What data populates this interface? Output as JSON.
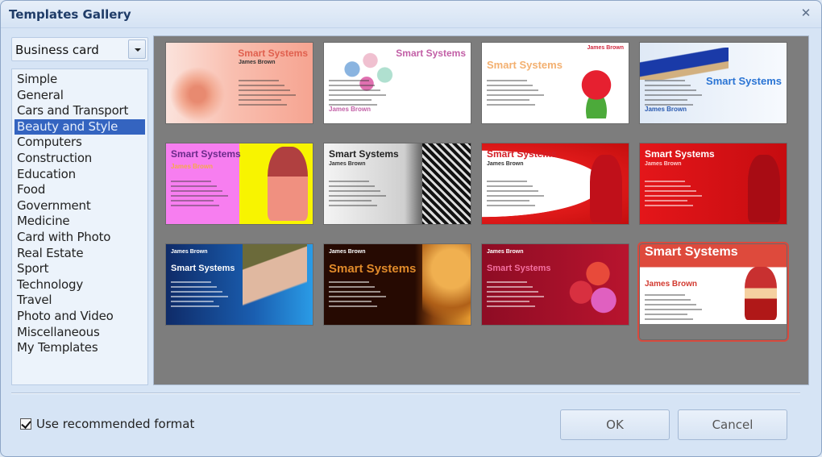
{
  "window": {
    "title": "Templates Gallery",
    "close_icon": "close-icon"
  },
  "category_select": {
    "value": "Business card"
  },
  "categories": {
    "items": [
      {
        "label": "Simple"
      },
      {
        "label": "General"
      },
      {
        "label": "Cars and Transport"
      },
      {
        "label": "Beauty and Style",
        "selected": true
      },
      {
        "label": "Computers"
      },
      {
        "label": "Construction"
      },
      {
        "label": "Education"
      },
      {
        "label": "Food"
      },
      {
        "label": "Government"
      },
      {
        "label": "Medicine"
      },
      {
        "label": "Card with Photo"
      },
      {
        "label": "Real Estate"
      },
      {
        "label": "Sport"
      },
      {
        "label": "Technology"
      },
      {
        "label": "Travel"
      },
      {
        "label": "Photo and Video"
      },
      {
        "label": "Miscellaneous"
      },
      {
        "label": "My Templates"
      }
    ]
  },
  "gallery": {
    "templates": [
      {
        "brand": "Smart Systems",
        "name": "James Brown",
        "theme": "peach-pearls",
        "colors": {
          "bg": "#f7b2a2",
          "brand": "#e0604e",
          "name": "#333333"
        }
      },
      {
        "brand": "Smart Systems",
        "name": "James Brown",
        "theme": "eyeshadow",
        "colors": {
          "bg": "#ffffff",
          "brand": "#c25fa6",
          "name": "#c25fa6"
        }
      },
      {
        "brand": "Smart Systems",
        "name": "James Brown",
        "theme": "rose",
        "colors": {
          "bg": "#ffffff",
          "brand": "#f3b070",
          "name": "#d02a40"
        }
      },
      {
        "brand": "Smart Systems",
        "name": "James Brown",
        "theme": "mascara",
        "colors": {
          "bg": "#eef4fb",
          "brand": "#2a74d4",
          "name": "#2a5ab0"
        }
      },
      {
        "brand": "Smart Systems",
        "name": "James Brown",
        "theme": "pink-yellow",
        "colors": {
          "bg": "#f77ef0",
          "brand": "#6a2a8a",
          "name": "#f6a84a"
        }
      },
      {
        "brand": "Smart Systems",
        "name": "James Brown",
        "theme": "silver-lace",
        "colors": {
          "bg": "#e6e6e6",
          "brand": "#222222",
          "name": "#333333"
        }
      },
      {
        "brand": "Smart Systems",
        "name": "James Brown",
        "theme": "red-silhouette-white",
        "colors": {
          "bg": "#d81818",
          "brand": "#d31e26",
          "name": "#333333"
        }
      },
      {
        "brand": "Smart Systems",
        "name": "James Brown",
        "theme": "red-silhouette",
        "colors": {
          "bg": "#d81818",
          "brand": "#ffffff",
          "name": "#ffd0d0"
        }
      },
      {
        "brand": "Smart Systems",
        "name": "James Brown",
        "theme": "blue-legs",
        "colors": {
          "bg": "#123a7a",
          "brand": "#ffffff",
          "name": "#ffffff"
        }
      },
      {
        "brand": "Smart Systems",
        "name": "James Brown",
        "theme": "amber-face",
        "colors": {
          "bg": "#2a0e04",
          "brand": "#e08a2a",
          "name": "#ffffff"
        }
      },
      {
        "brand": "Smart Systems",
        "name": "James Brown",
        "theme": "crimson-compacts",
        "colors": {
          "bg": "#a8122e",
          "brand": "#f470a0",
          "name": "#ffffff"
        }
      },
      {
        "brand": "Smart Systems",
        "name": "James Brown",
        "theme": "red-header",
        "selected": true,
        "colors": {
          "bg": "#ffffff",
          "brand": "#ffffff",
          "name": "#d23a30"
        }
      }
    ]
  },
  "footer": {
    "checkbox_label": "Use recommended format",
    "checkbox_checked": true,
    "ok_label": "OK",
    "cancel_label": "Cancel"
  }
}
